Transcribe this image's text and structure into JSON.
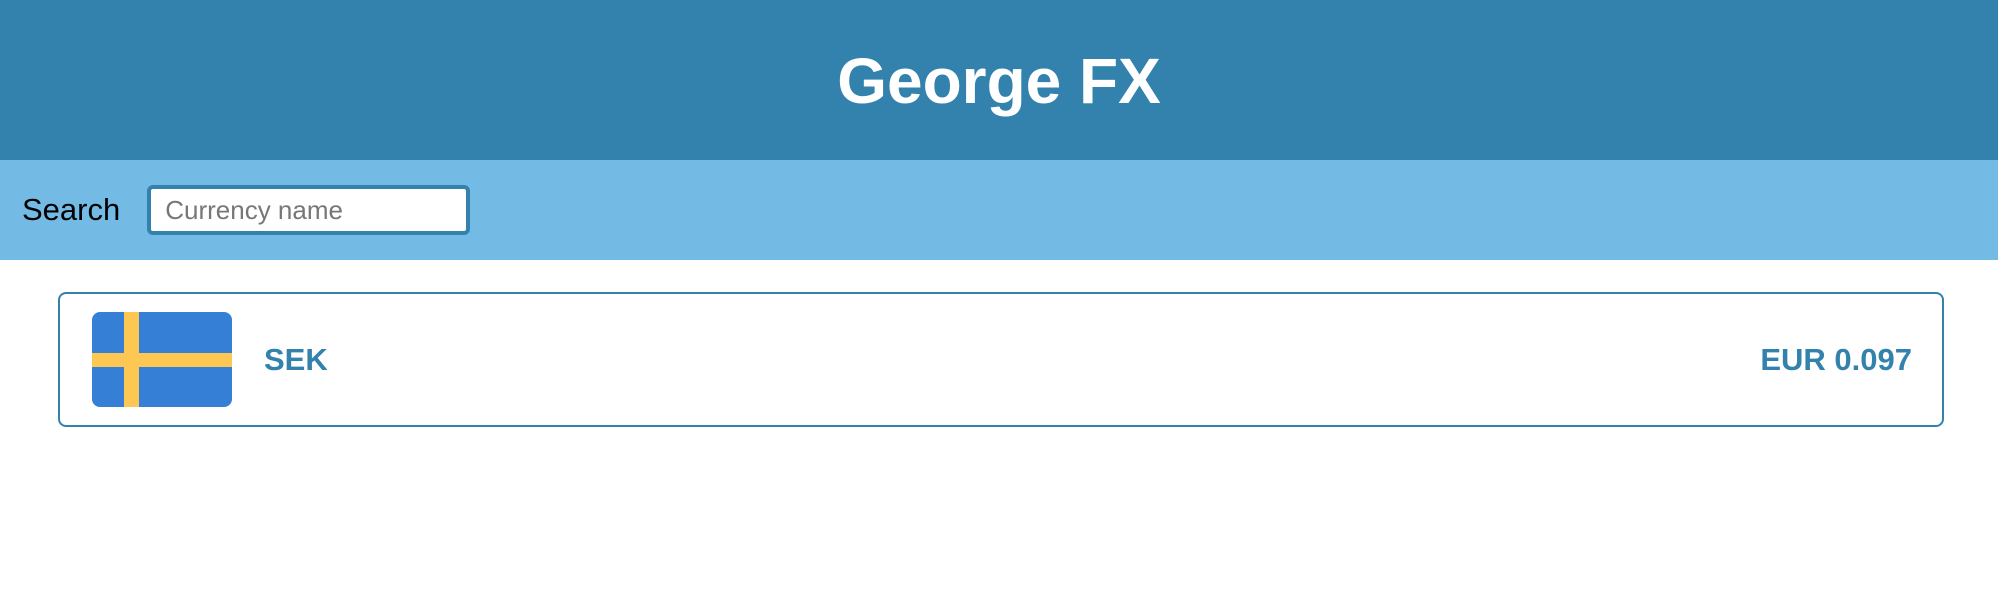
{
  "header": {
    "title": "George FX",
    "background": "#3282ad"
  },
  "search": {
    "label": "Search",
    "placeholder": "Currency name",
    "value": "",
    "background": "#73bbe5"
  },
  "currencies": [
    {
      "code": "SEK",
      "flag_icon": "sweden-flag-icon",
      "flag_colors": {
        "field": "#367fd6",
        "cross": "#fcc752"
      },
      "rate": "EUR 0.097"
    }
  ],
  "colors": {
    "accent": "#3282ad",
    "text": "#000000"
  }
}
